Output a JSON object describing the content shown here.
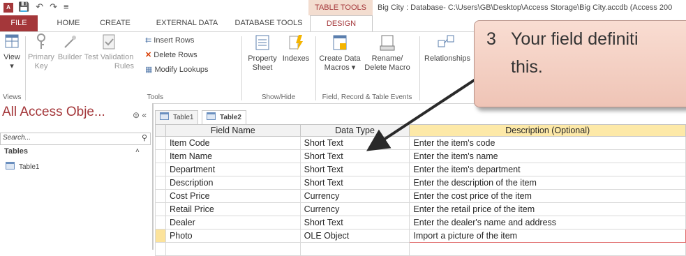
{
  "titlebar": {
    "app_icon": "A",
    "qat": [
      "💾",
      "↶",
      "↷",
      "≡"
    ],
    "contextual_tab": "TABLE TOOLS",
    "title": "Big City : Database- C:\\Users\\GB\\Desktop\\Access Storage\\Big City.accdb (Access 200"
  },
  "tabs": [
    "FILE",
    "HOME",
    "CREATE",
    "EXTERNAL DATA",
    "DATABASE TOOLS",
    "DESIGN"
  ],
  "ribbon": {
    "view": "View",
    "primary_key_1": "Primary",
    "primary_key_2": "Key",
    "builder": "Builder",
    "test_validation_1": "Test Validation",
    "test_validation_2": "Rules",
    "insert_rows": "Insert Rows",
    "delete_rows": "Delete Rows",
    "modify_lookups": "Modify Lookups",
    "property_sheet_1": "Property",
    "property_sheet_2": "Sheet",
    "indexes": "Indexes",
    "create_data_macros_1": "Create Data",
    "create_data_macros_2": "Macros ▾",
    "rename_delete_macro_1": "Rename/",
    "rename_delete_macro_2": "Delete Macro",
    "relationships": "Relationships",
    "groups": {
      "views": "Views",
      "tools": "Tools",
      "show_hide": "Show/Hide",
      "field_record": "Field, Record & Table Events",
      "relationships": "Relationships"
    }
  },
  "nav": {
    "title": "All Access Obje...",
    "controls": "⊜ «",
    "search_placeholder": "Search...",
    "section": "Tables",
    "section_chevron": "˄",
    "items": [
      "Table1"
    ]
  },
  "doc_tabs": [
    "Table1",
    "Table2"
  ],
  "grid": {
    "headers": [
      "Field Name",
      "Data Type",
      "Description (Optional)"
    ],
    "rows": [
      {
        "field": "Item Code",
        "type": "Short Text",
        "desc": "Enter the item's code"
      },
      {
        "field": "Item Name",
        "type": "Short Text",
        "desc": "Enter the item's name"
      },
      {
        "field": "Department",
        "type": "Short Text",
        "desc": "Enter the item's department"
      },
      {
        "field": "Description",
        "type": "Short Text",
        "desc": "Enter the description of the item"
      },
      {
        "field": "Cost Price",
        "type": "Currency",
        "desc": "Enter the cost price of the item"
      },
      {
        "field": "Retail Price",
        "type": "Currency",
        "desc": "Enter the retail price of the item"
      },
      {
        "field": "Dealer",
        "type": "Short Text",
        "desc": "Enter the dealer's name and address"
      },
      {
        "field": "Photo",
        "type": "OLE Object",
        "desc": "Import a picture of the item"
      },
      {
        "field": "",
        "type": "",
        "desc": ""
      }
    ]
  },
  "callout": {
    "number": "3",
    "line1": "Your field definiti",
    "line2": "this."
  },
  "colors": {
    "accent": "#a4373a",
    "callout_fill": "#f4cfc3",
    "selector_highlight": "#fce39b"
  }
}
